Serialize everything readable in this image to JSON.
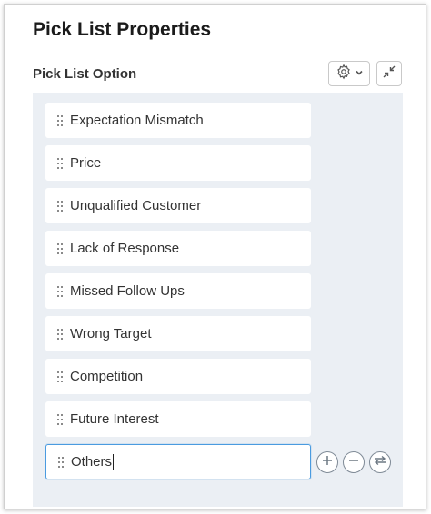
{
  "title": "Pick List Properties",
  "section_label": "Pick List Option",
  "icons": {
    "settings": "gear-icon",
    "dropdown": "chevron-down-icon",
    "collapse": "collapse-icon",
    "drag": "drag-handle-icon",
    "add": "plus-circle-icon",
    "remove": "minus-circle-icon",
    "swap": "swap-icon"
  },
  "options": [
    {
      "label": "Expectation Mismatch"
    },
    {
      "label": "Price"
    },
    {
      "label": "Unqualified Customer"
    },
    {
      "label": "Lack of Response"
    },
    {
      "label": "Missed Follow Ups"
    },
    {
      "label": "Wrong Target"
    },
    {
      "label": "Competition"
    },
    {
      "label": "Future Interest"
    },
    {
      "label": "Others",
      "editing": true
    }
  ],
  "colors": {
    "accent": "#4a9be0",
    "list_background": "#ebeff4"
  }
}
